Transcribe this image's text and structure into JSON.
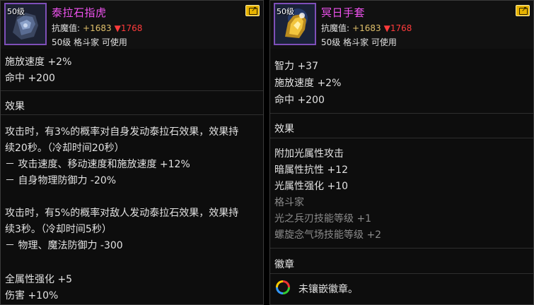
{
  "left": {
    "level_tag": "50级",
    "name": "泰拉石指虎",
    "resist_label": "抗魔值:",
    "resist_up": "+1683",
    "resist_down": "▼1768",
    "class_line": "50级 格斗家 可使用",
    "stats": [
      "施放速度 +2%",
      "命中 +200"
    ],
    "effect_title": "效果",
    "effect_lines": [
      "攻击时，有3%的概率对自身发动泰拉石效果，效果持",
      "续20秒。（冷却时间20秒）",
      "－ 攻击速度、移动速度和施放速度 +12%",
      "－ 自身物理防御力 -20%",
      "攻击时，有5%的概率对敌人发动泰拉石效果，效果持",
      "续3秒。（冷却时间5秒）",
      "－ 物理、魔法防御力 -300",
      "全属性强化 +5",
      "伤害 +10%"
    ]
  },
  "right": {
    "level_tag": "50级",
    "name": "冥日手套",
    "resist_label": "抗魔值:",
    "resist_up": "+1683",
    "resist_down": "▼1768",
    "class_line": "50级 格斗家 可使用",
    "stats": [
      "智力 +37",
      "施放速度 +2%",
      "命中 +200"
    ],
    "effect_title": "效果",
    "effect_lines": [
      "附加光属性攻击",
      "暗属性抗性 +12",
      "光属性强化 +10"
    ],
    "gray_lines": [
      "格斗家",
      "光之兵刃技能等级 +1",
      "螺旋念气场技能等级 +2"
    ],
    "emblem_title": "徽章",
    "emblem_text": "未镶嵌徽章。"
  },
  "colors": {
    "item_name": "#f052f0",
    "resist_up": "#e0c06a",
    "resist_down": "#ff3b3b",
    "icon_border": "#7e4fb8",
    "share_button": "#e7b300"
  },
  "icons": [
    "gauntlet-icon",
    "golden-glove-icon",
    "share-icon",
    "emblem-slot-icon"
  ]
}
